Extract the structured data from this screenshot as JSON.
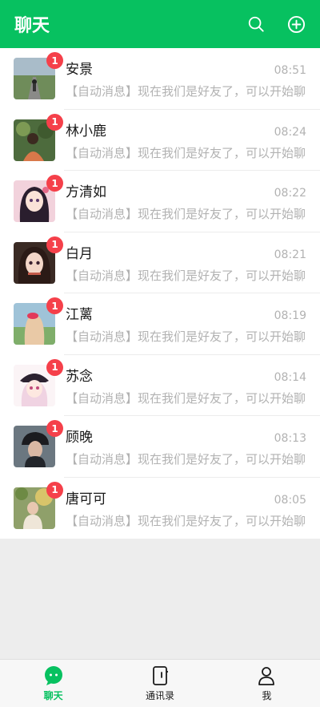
{
  "header": {
    "title": "聊天",
    "search_icon": "search-icon",
    "add_icon": "plus-circle-icon"
  },
  "colors": {
    "accent": "#07c160",
    "badge": "#f5404a"
  },
  "chats": [
    {
      "name": "安景",
      "time": "08:51",
      "message": "【自动消息】现在我们是好友了，可以开始聊..",
      "badge": "1"
    },
    {
      "name": "林小鹿",
      "time": "08:24",
      "message": "【自动消息】现在我们是好友了，可以开始聊..",
      "badge": "1"
    },
    {
      "name": "方清如",
      "time": "08:22",
      "message": "【自动消息】现在我们是好友了，可以开始聊..",
      "badge": "1"
    },
    {
      "name": "白月",
      "time": "08:21",
      "message": "【自动消息】现在我们是好友了，可以开始聊..",
      "badge": "1"
    },
    {
      "name": "江蓠",
      "time": "08:19",
      "message": "【自动消息】现在我们是好友了，可以开始聊..",
      "badge": "1"
    },
    {
      "name": "苏念",
      "time": "08:14",
      "message": "【自动消息】现在我们是好友了，可以开始聊..",
      "badge": "1"
    },
    {
      "name": "顾晚",
      "time": "08:13",
      "message": "【自动消息】现在我们是好友了，可以开始聊..",
      "badge": "1"
    },
    {
      "name": "唐可可",
      "time": "08:05",
      "message": "【自动消息】现在我们是好友了，可以开始聊..",
      "badge": "1"
    }
  ],
  "tabs": [
    {
      "label": "聊天",
      "icon": "chat-bubble-icon",
      "active": true
    },
    {
      "label": "通讯录",
      "icon": "contacts-book-icon",
      "active": false
    },
    {
      "label": "我",
      "icon": "person-icon",
      "active": false
    }
  ]
}
